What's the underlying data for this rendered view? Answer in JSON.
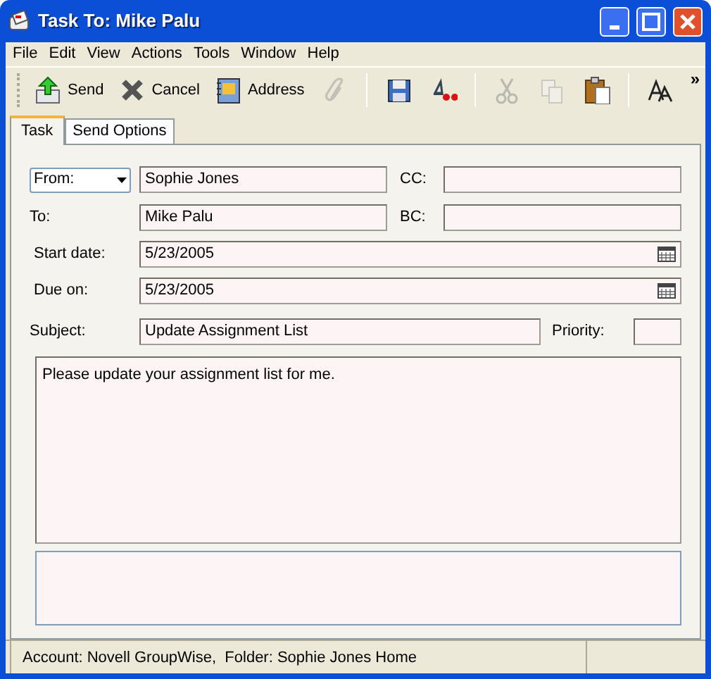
{
  "window": {
    "title": "Task To: Mike Palu"
  },
  "menu": [
    "File",
    "Edit",
    "View",
    "Actions",
    "Tools",
    "Window",
    "Help"
  ],
  "toolbar": [
    {
      "kind": "send",
      "label": "Send",
      "disabled": false
    },
    {
      "kind": "cancel",
      "label": "Cancel",
      "disabled": false
    },
    {
      "kind": "address",
      "label": "Address",
      "disabled": false
    },
    {
      "kind": "attach",
      "disabled": true
    },
    {
      "kind": "sep"
    },
    {
      "kind": "save",
      "disabled": false
    },
    {
      "kind": "spell",
      "disabled": false
    },
    {
      "kind": "sep"
    },
    {
      "kind": "cut",
      "disabled": true
    },
    {
      "kind": "copy",
      "disabled": true
    },
    {
      "kind": "paste",
      "disabled": false
    },
    {
      "kind": "sep"
    },
    {
      "kind": "font",
      "disabled": false
    }
  ],
  "toolbar_overflow": "»",
  "tabs": [
    {
      "label": "Task",
      "selected": true
    },
    {
      "label": "Send Options",
      "selected": false
    }
  ],
  "form": {
    "from": {
      "label": "From:",
      "value": "Sophie Jones"
    },
    "cc": {
      "label": "CC:"
    },
    "to": {
      "label": "To:",
      "value": "Mike Palu"
    },
    "bc": {
      "label": "BC:"
    },
    "start_date": {
      "label": "Start date:",
      "value": "5/23/2005"
    },
    "due_on": {
      "label": "Due on:",
      "value": "5/23/2005"
    },
    "subject": {
      "label": "Subject:",
      "value": "Update Assignment List"
    },
    "priority": {
      "label": "Priority:"
    },
    "message": "Please update your assignment list for me."
  },
  "status_bar": [
    "Account: Novell GroupWise,  Folder: Sophie Jones Home"
  ]
}
